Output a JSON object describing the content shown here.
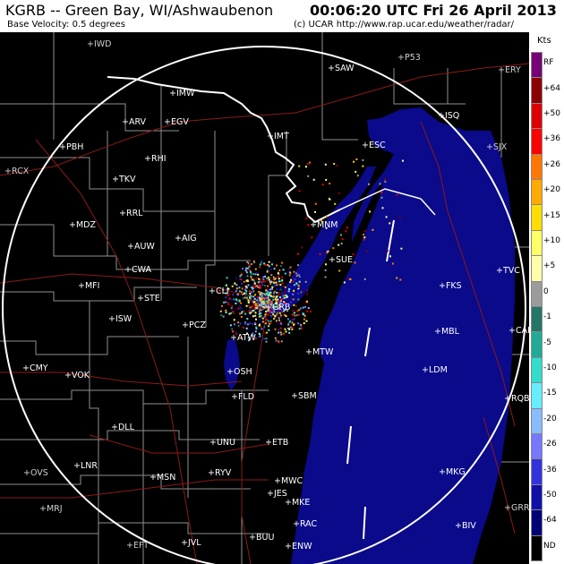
{
  "header": {
    "station": "KGRB -- Green Bay, WI/Ashwaubenon",
    "product": "Base Velocity: 0.5 degrees",
    "datetime": "00:06:20 UTC Fri 26 April 2013",
    "credit": "(c) UCAR  http://www.rap.ucar.edu/weather/radar/"
  },
  "legend": {
    "unit": "Kts",
    "entries": [
      {
        "label": "RF",
        "color": "#770077"
      },
      {
        "label": "+64",
        "color": "#8B0000"
      },
      {
        "label": "+50",
        "color": "#DD0000"
      },
      {
        "label": "+36",
        "color": "#FF0000"
      },
      {
        "label": "+26",
        "color": "#FF7700"
      },
      {
        "label": "+20",
        "color": "#FFAA00"
      },
      {
        "label": "+15",
        "color": "#FFDD00"
      },
      {
        "label": "+10",
        "color": "#FFFF66"
      },
      {
        "label": "+5",
        "color": "#FFFFAA"
      },
      {
        "label": "0",
        "color": "#9B9B9B"
      },
      {
        "label": "-1",
        "color": "#227766"
      },
      {
        "label": "-5",
        "color": "#22AA99"
      },
      {
        "label": "-10",
        "color": "#33DDCC"
      },
      {
        "label": "-15",
        "color": "#66EEFF"
      },
      {
        "label": "-20",
        "color": "#88BBFF"
      },
      {
        "label": "-26",
        "color": "#7777FF"
      },
      {
        "label": "-36",
        "color": "#3333DD"
      },
      {
        "label": "-50",
        "color": "#1111AA"
      },
      {
        "label": "-64",
        "color": "#000077"
      },
      {
        "label": "ND",
        "color": "#000000"
      }
    ]
  },
  "cities": [
    {
      "name": "IWD",
      "far": true
    },
    {
      "name": "SAW"
    },
    {
      "name": "P53",
      "far": true
    },
    {
      "name": "ERY",
      "far": true
    },
    {
      "name": "IMW"
    },
    {
      "name": "ARV"
    },
    {
      "name": "EGV"
    },
    {
      "name": "ISQ"
    },
    {
      "name": "PBH"
    },
    {
      "name": "RHI"
    },
    {
      "name": "IMT"
    },
    {
      "name": "ESC"
    },
    {
      "name": "SJX",
      "far": true
    },
    {
      "name": "RCX",
      "far": true
    },
    {
      "name": "TKV"
    },
    {
      "name": "RRL"
    },
    {
      "name": "MNM"
    },
    {
      "name": "MDZ"
    },
    {
      "name": "AIG"
    },
    {
      "name": "AUW"
    },
    {
      "name": "SUE"
    },
    {
      "name": "CWA"
    },
    {
      "name": "TVC"
    },
    {
      "name": "MFI"
    },
    {
      "name": "CLI"
    },
    {
      "name": "FKS"
    },
    {
      "name": "STE"
    },
    {
      "name": "GRB"
    },
    {
      "name": "ISW"
    },
    {
      "name": "PCZ"
    },
    {
      "name": "MBL"
    },
    {
      "name": "CAD"
    },
    {
      "name": "ATW"
    },
    {
      "name": "MTW"
    },
    {
      "name": "CMY"
    },
    {
      "name": "LDM"
    },
    {
      "name": "VOK"
    },
    {
      "name": "OSH"
    },
    {
      "name": "FLD"
    },
    {
      "name": "SBM"
    },
    {
      "name": "RQB"
    },
    {
      "name": "DLL"
    },
    {
      "name": "UNU"
    },
    {
      "name": "ETB"
    },
    {
      "name": "LNR"
    },
    {
      "name": "OVS",
      "far": true
    },
    {
      "name": "MSN"
    },
    {
      "name": "RYV"
    },
    {
      "name": "MKG"
    },
    {
      "name": "MWC"
    },
    {
      "name": "JES"
    },
    {
      "name": "MKE"
    },
    {
      "name": "MRJ",
      "far": true
    },
    {
      "name": "GRR",
      "far": true
    },
    {
      "name": "RAC"
    },
    {
      "name": "BIV"
    },
    {
      "name": "EFT",
      "far": true
    },
    {
      "name": "JVL"
    },
    {
      "name": "BUU"
    },
    {
      "name": "ENW"
    }
  ]
}
